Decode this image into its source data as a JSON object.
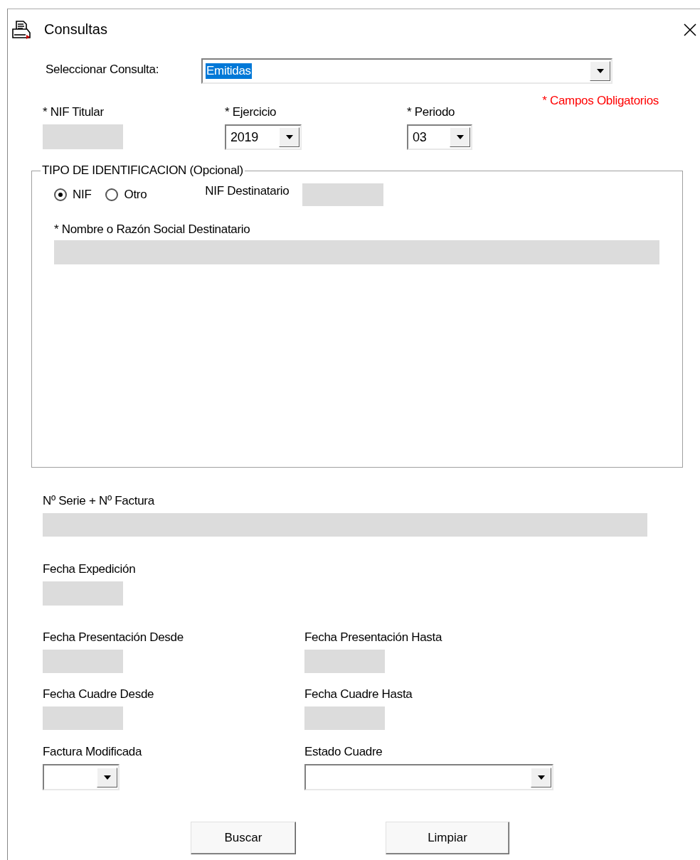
{
  "window": {
    "title": "Consultas"
  },
  "consulta": {
    "label": "Seleccionar Consulta:",
    "value": "Emitidas"
  },
  "required_note": "* Campos Obligatorios",
  "nif_titular": {
    "label": "* NIF Titular"
  },
  "ejercicio": {
    "label": "* Ejercicio",
    "value": "2019"
  },
  "periodo": {
    "label": "* Periodo",
    "value": "03"
  },
  "identificacion": {
    "title": "TIPO DE IDENTIFICACION (Opcional)",
    "options": [
      {
        "label": "NIF",
        "selected": true
      },
      {
        "label": "Otro",
        "selected": false
      }
    ],
    "nif_destinatario": {
      "label": "NIF Destinatario"
    },
    "nombre": {
      "label": "* Nombre o Razón Social Destinatario"
    }
  },
  "serie_factura": {
    "label": "Nº Serie + Nº Factura"
  },
  "fecha_expedicion": {
    "label": "Fecha Expedición"
  },
  "fecha_presentacion": [
    {
      "label": "Fecha Presentación Desde"
    },
    {
      "label": "Fecha Presentación Hasta"
    }
  ],
  "fecha_cuadre": [
    {
      "label": "Fecha Cuadre Desde"
    },
    {
      "label": "Fecha Cuadre Hasta"
    }
  ],
  "factura_modificada": {
    "label": "Factura Modificada"
  },
  "estado_cuadre": {
    "label": "Estado Cuadre"
  },
  "buttons": [
    "Buscar",
    "Limpiar"
  ]
}
